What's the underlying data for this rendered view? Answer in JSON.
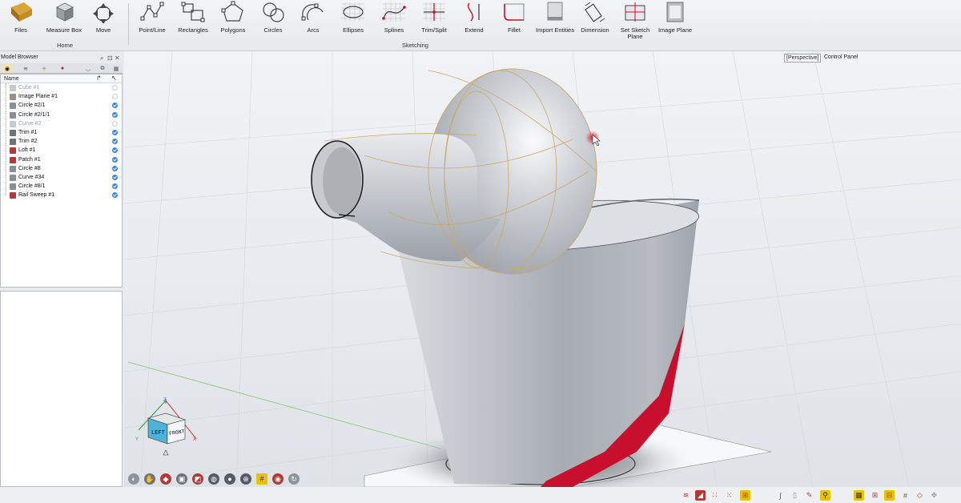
{
  "ribbon": {
    "groups": [
      {
        "label": "Home"
      },
      {
        "label": "Sketching"
      }
    ],
    "tools": [
      {
        "label": "Files",
        "icon": "files-icon"
      },
      {
        "label": "Measure Box",
        "icon": "measure-box-icon"
      },
      {
        "label": "Move",
        "icon": "move-icon"
      },
      {
        "label": "Point/Line",
        "icon": "point-line-icon"
      },
      {
        "label": "Rectangles",
        "icon": "rectangles-icon"
      },
      {
        "label": "Polygons",
        "icon": "polygons-icon"
      },
      {
        "label": "Circles",
        "icon": "circles-icon"
      },
      {
        "label": "Arcs",
        "icon": "arcs-icon"
      },
      {
        "label": "Ellipses",
        "icon": "ellipses-icon"
      },
      {
        "label": "Splines",
        "icon": "splines-icon"
      },
      {
        "label": "Trim/Split",
        "icon": "trim-split-icon"
      },
      {
        "label": "Extend",
        "icon": "extend-icon"
      },
      {
        "label": "Fillet",
        "icon": "fillet-icon"
      },
      {
        "label": "Import Entities",
        "icon": "import-entities-icon"
      },
      {
        "label": "Dimension",
        "icon": "dimension-icon"
      },
      {
        "label": "Set Sketch Plane",
        "icon": "set-sketch-plane-icon"
      },
      {
        "label": "Image Plane",
        "icon": "image-plane-icon"
      }
    ]
  },
  "model_browser": {
    "title": "Model Browser",
    "column_name": "Name",
    "items": [
      {
        "name": "Cube #1",
        "visible": false,
        "hidden": true,
        "icon_color": "#c7c9cc"
      },
      {
        "name": "Image Plane #1",
        "visible": false,
        "hidden": false,
        "icon_color": "#9a8f86"
      },
      {
        "name": "Circle #2/1",
        "visible": true,
        "hidden": false,
        "icon_color": "#8a8f96"
      },
      {
        "name": "Circle #2/1/1",
        "visible": true,
        "hidden": false,
        "icon_color": "#8a8f96"
      },
      {
        "name": "Curve #2",
        "visible": false,
        "hidden": true,
        "icon_color": "#c7c9cc"
      },
      {
        "name": "Trim #1",
        "visible": true,
        "hidden": false,
        "icon_color": "#6d7378"
      },
      {
        "name": "Trim #2",
        "visible": true,
        "hidden": false,
        "icon_color": "#6d7378"
      },
      {
        "name": "Loft #1",
        "visible": true,
        "hidden": false,
        "icon_color": "#b33a3a"
      },
      {
        "name": "Patch #1",
        "visible": true,
        "hidden": false,
        "icon_color": "#b33a3a"
      },
      {
        "name": "Circle #8",
        "visible": true,
        "hidden": false,
        "icon_color": "#8a8f96"
      },
      {
        "name": "Curve #34",
        "visible": true,
        "hidden": false,
        "icon_color": "#8a8f96"
      },
      {
        "name": "Circle #8/1",
        "visible": true,
        "hidden": false,
        "icon_color": "#8a8f96"
      },
      {
        "name": "Rail Sweep #1",
        "visible": true,
        "hidden": false,
        "icon_color": "#b33a3a"
      }
    ]
  },
  "viewport": {
    "view_mode": "[Perspective]",
    "control_panel_label": "Control Panel",
    "cube_faces": {
      "left": "LEFT",
      "front": "FRONT"
    },
    "axis_labels": {
      "x": "X",
      "y": "Y",
      "z": "Z"
    }
  },
  "colors": {
    "accent": "#3a86d8",
    "surface": "#b9bdc3",
    "highlight_red": "#c8102e",
    "isoparm": "#c8a96a"
  }
}
